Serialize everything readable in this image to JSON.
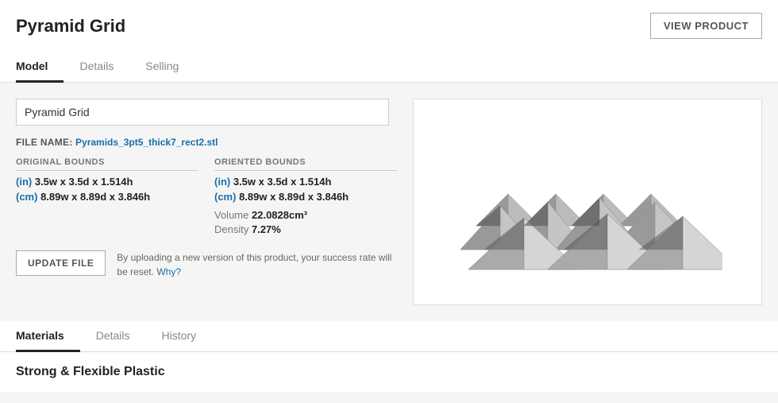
{
  "header": {
    "title": "Pyramid Grid",
    "view_product_label": "VIEW PRODUCT"
  },
  "main_tabs": [
    {
      "label": "Model",
      "active": true
    },
    {
      "label": "Details",
      "active": false
    },
    {
      "label": "Selling",
      "active": false
    }
  ],
  "model_name_input": {
    "value": "Pyramid Grid",
    "placeholder": "Model name"
  },
  "file_name": {
    "label": "FILE NAME:",
    "value": "Pyramids_3pt5_thick7_rect2.stl"
  },
  "original_bounds": {
    "header": "ORIGINAL BOUNDS",
    "in_dims": "3.5w x 3.5d x 1.514h",
    "cm_dims": "8.89w x 8.89d x 3.846h",
    "in_unit": "(in)",
    "cm_unit": "(cm)"
  },
  "oriented_bounds": {
    "header": "ORIENTED BOUNDS",
    "in_dims": "3.5w x 3.5d x 1.514h",
    "cm_dims": "8.89w x 8.89d x 3.846h",
    "in_unit": "(in)",
    "cm_unit": "(cm)",
    "volume_label": "Volume",
    "volume_value": "22.0828cm³",
    "density_label": "Density",
    "density_value": "7.27%"
  },
  "update_file": {
    "button_label": "UPDATE FILE",
    "note": "By uploading a new version of this product, your success rate will be reset.",
    "why_label": "Why?"
  },
  "sub_tabs": [
    {
      "label": "Materials",
      "active": true
    },
    {
      "label": "Details",
      "active": false
    },
    {
      "label": "History",
      "active": false
    }
  ],
  "materials_section": {
    "heading": "Strong & Flexible Plastic"
  }
}
